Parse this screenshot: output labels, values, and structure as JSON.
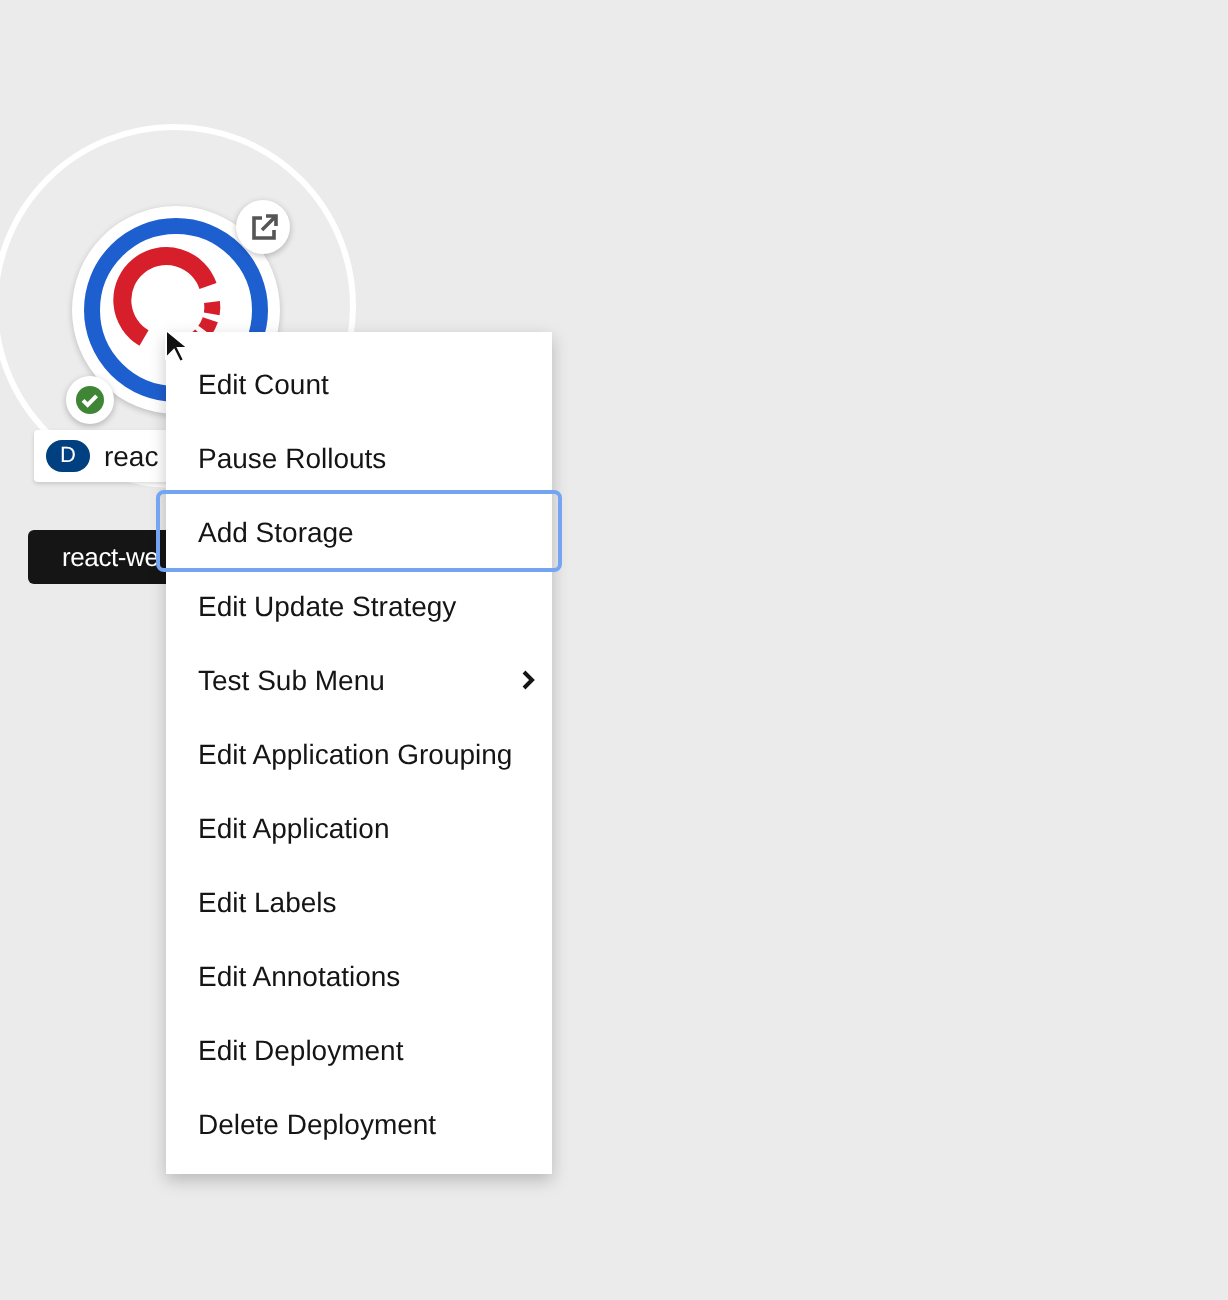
{
  "node": {
    "badge": "D",
    "name": "reac",
    "tooltip": "react-we",
    "ready": true
  },
  "context_menu": {
    "items": [
      {
        "label": "Edit Count",
        "kind": "action",
        "selected": false
      },
      {
        "label": "Pause Rollouts",
        "kind": "action",
        "selected": false
      },
      {
        "label": "Add Storage",
        "kind": "action",
        "selected": true
      },
      {
        "label": "Edit Update Strategy",
        "kind": "action",
        "selected": false
      },
      {
        "label": "Test Sub Menu",
        "kind": "submenu",
        "selected": false
      },
      {
        "label": "Edit Application Grouping",
        "kind": "action",
        "selected": false
      },
      {
        "label": "Edit Application",
        "kind": "action",
        "selected": false
      },
      {
        "label": "Edit Labels",
        "kind": "action",
        "selected": false
      },
      {
        "label": "Edit Annotations",
        "kind": "action",
        "selected": false
      },
      {
        "label": "Edit Deployment",
        "kind": "action",
        "selected": false
      },
      {
        "label": "Delete Deployment",
        "kind": "action",
        "selected": false
      }
    ]
  }
}
